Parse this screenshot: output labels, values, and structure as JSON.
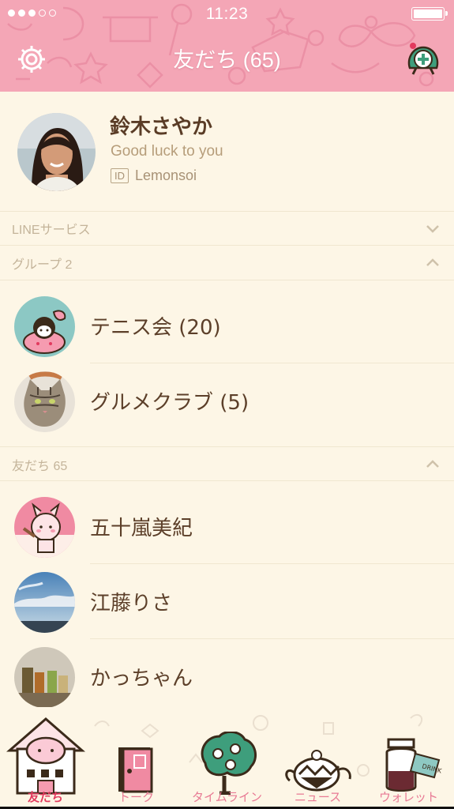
{
  "status_bar": {
    "time": "11:23"
  },
  "header": {
    "title": "友だち (65)"
  },
  "profile": {
    "name": "鈴木さやか",
    "status_message": "Good luck to you",
    "id_badge": "ID",
    "id_value": "Lemonsoi"
  },
  "sections": {
    "line_services": {
      "label": "LINEサービス",
      "state": "collapsed"
    },
    "groups": {
      "label": "グループ 2",
      "state": "expanded"
    },
    "friends": {
      "label": "友だち 65",
      "state": "expanded"
    }
  },
  "groups": [
    {
      "name": "テニス会 (20)",
      "avatar": "pink-bunny-sticker"
    },
    {
      "name": "グルメクラブ (5)",
      "avatar": "tabby-cat-photo"
    }
  ],
  "friends": [
    {
      "name": "五十嵐美紀",
      "avatar": "pink-bunny-brush-sticker"
    },
    {
      "name": "江藤りさ",
      "avatar": "sky-clouds-photo"
    },
    {
      "name": "かっちゃん",
      "avatar": "drinks-photo"
    }
  ],
  "tabs": [
    {
      "label": "友だち",
      "icon": "bunny-house-icon",
      "active": true
    },
    {
      "label": "トーク",
      "icon": "door-icon",
      "active": false
    },
    {
      "label": "タイムライン",
      "icon": "tree-icon",
      "active": false
    },
    {
      "label": "ニュース",
      "icon": "teapot-icon",
      "active": false
    },
    {
      "label": "ウォレット",
      "icon": "drink-me-bottle-icon",
      "active": false
    }
  ],
  "colors": {
    "header_bg": "#f4a6b6",
    "page_bg": "#fdf6e6",
    "name_text": "#5c3f29",
    "muted_text": "#b69d7a",
    "tab_active": "#e23a5e",
    "tab_inactive": "#e87a94"
  }
}
